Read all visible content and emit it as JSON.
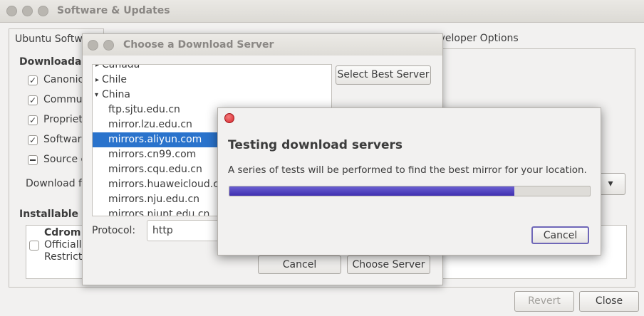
{
  "window": {
    "title": "Software & Updates"
  },
  "tabs": [
    {
      "label": "Ubuntu Softw"
    },
    {
      "label": "eveloper Options"
    }
  ],
  "ubuntu_tab": {
    "downloadable_heading": "Downloadab",
    "checkboxes": [
      {
        "label": "Canonic",
        "state": "checked"
      },
      {
        "label": "Commu",
        "state": "checked"
      },
      {
        "label": "Propriet",
        "state": "checked"
      },
      {
        "label": "Softwar",
        "state": "checked"
      },
      {
        "label": "Source c",
        "state": "mixed"
      }
    ],
    "download_from_label": "Download f",
    "installable_heading": "Installable f",
    "cdrom": {
      "title": "Cdrom w",
      "line1": "Officiall",
      "line2": "Restrict"
    }
  },
  "main_buttons": {
    "revert": "Revert",
    "close": "Close"
  },
  "server_dialog": {
    "title": "Choose a Download Server",
    "select_best_label": "Select Best Server",
    "tree": [
      {
        "label": "Canada",
        "type": "country",
        "expander": "▸"
      },
      {
        "label": "Chile",
        "type": "country",
        "expander": "▸"
      },
      {
        "label": "China",
        "type": "country",
        "expander": "▾"
      },
      {
        "label": "ftp.sjtu.edu.cn",
        "type": "server"
      },
      {
        "label": "mirror.lzu.edu.cn",
        "type": "server"
      },
      {
        "label": "mirrors.aliyun.com",
        "type": "server",
        "selected": true
      },
      {
        "label": "mirrors.cn99.com",
        "type": "server"
      },
      {
        "label": "mirrors.cqu.edu.cn",
        "type": "server"
      },
      {
        "label": "mirrors.huaweicloud.com",
        "type": "server"
      },
      {
        "label": "mirrors.nju.edu.cn",
        "type": "server"
      },
      {
        "label": "mirrors.njupt.edu.cn",
        "type": "server"
      }
    ],
    "protocol_label": "Protocol:",
    "protocol_value": "http",
    "cancel_label": "Cancel",
    "choose_label": "Choose Server"
  },
  "test_dialog": {
    "heading": "Testing download servers",
    "message": "A series of tests will be performed to find the best mirror for your location.",
    "progress": 0.79,
    "cancel_label": "Cancel"
  },
  "colors": {
    "selection": "#2a73cc",
    "progress": "#4a3bb8",
    "close_button": "#e03a3e"
  }
}
